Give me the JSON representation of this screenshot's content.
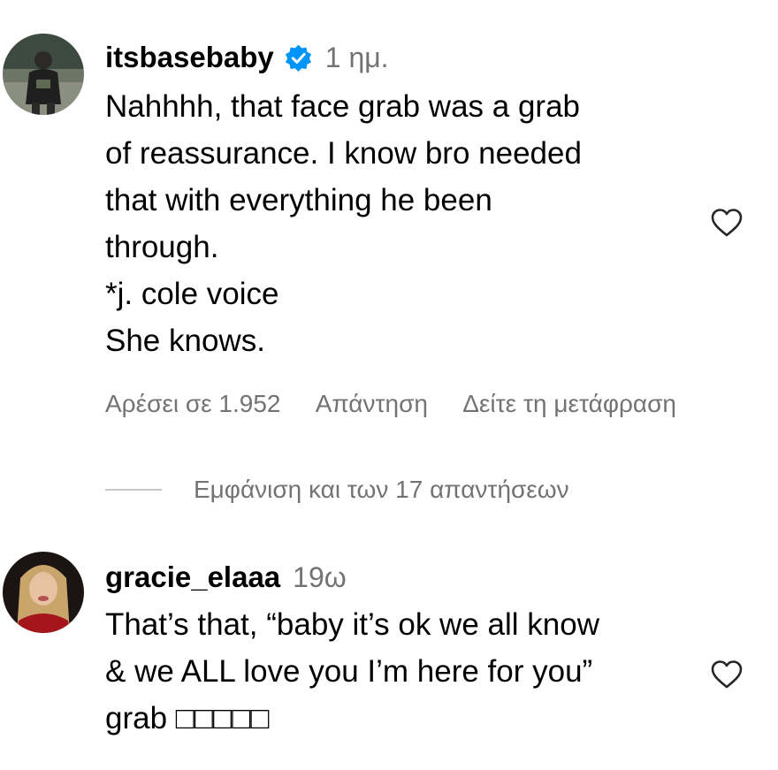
{
  "comments": [
    {
      "username": "itsbasebaby",
      "verified": true,
      "time": "1 ημ.",
      "lines": [
        "Nahhhh, that face grab was a grab",
        "of reassurance. I know bro needed",
        "that with everything he been",
        "through.",
        "*j. cole voice",
        "She knows."
      ],
      "actions": {
        "likes": "Αρέσει σε 1.952",
        "reply": "Απάντηση",
        "translate": "Δείτε τη μετάφραση"
      },
      "replies_label": "Εμφάνιση και των 17 απαντήσεων"
    },
    {
      "username": "gracie_elaaa",
      "verified": false,
      "time": "19ω",
      "lines": [
        "That’s that, “baby it’s ok we all know",
        "& we ALL love you I’m here for you”",
        "grab □□□□□"
      ]
    }
  ],
  "icons": {
    "verified": "verified-badge-icon",
    "like": "heart-outline-icon"
  },
  "colors": {
    "secondary_text": "#737373",
    "verified_blue": "#0095f6",
    "divider": "#c7c7c7"
  }
}
